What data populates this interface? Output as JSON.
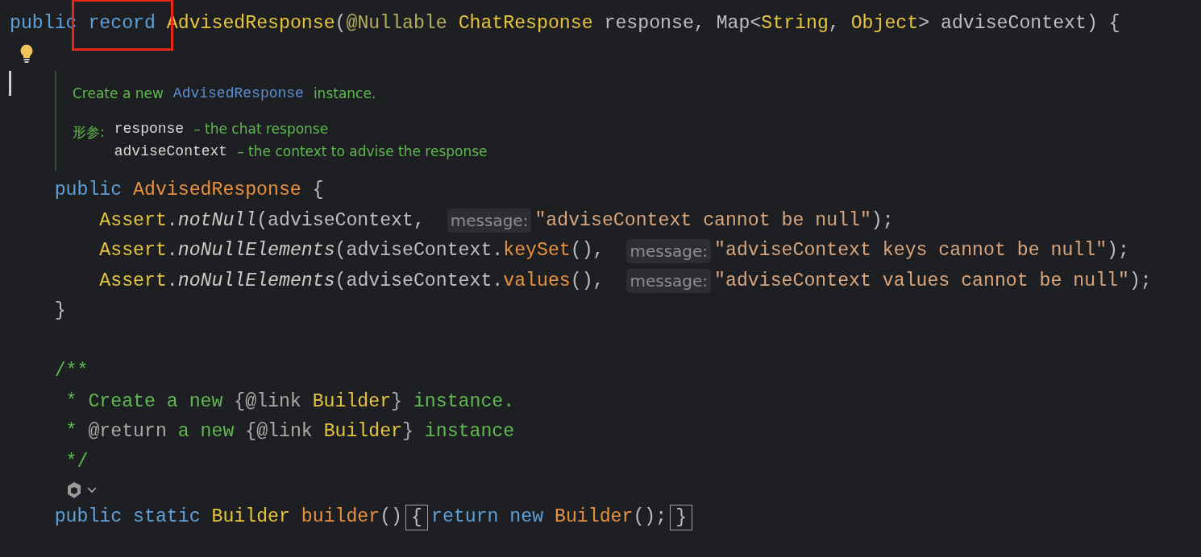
{
  "editor": {
    "lines": [
      {
        "kind": "code",
        "tokens": [
          {
            "text": "public ",
            "kind": "keyword"
          },
          {
            "text": "record",
            "kind": "keyword",
            "highlighted": true
          },
          {
            "text": " AdvisedResponse",
            "kind": "type"
          },
          {
            "text": "(",
            "kind": "plain"
          },
          {
            "text": "@Nullable ",
            "kind": "annotation"
          },
          {
            "text": "ChatResponse",
            "kind": "type"
          },
          {
            "text": " response, Map<",
            "kind": "plain"
          },
          {
            "text": "String",
            "kind": "type"
          },
          {
            "text": ", ",
            "kind": "plain"
          },
          {
            "text": "Object",
            "kind": "type"
          },
          {
            "text": "> adviseContext) {",
            "kind": "plain"
          }
        ]
      },
      {
        "kind": "bulb"
      },
      {
        "kind": "doc",
        "summary": [
          {
            "text": "Create a new",
            "kind": "text"
          },
          {
            "text": "AdvisedResponse",
            "kind": "code"
          },
          {
            "text": "instance.",
            "kind": "text"
          }
        ],
        "params_label": "形参:",
        "params": [
          {
            "name": "response",
            "description": "– the chat response"
          },
          {
            "name": "adviseContext",
            "description": "– the context to advise the response"
          }
        ]
      },
      {
        "kind": "code",
        "tokens": [
          {
            "text": "    public ",
            "kind": "keyword"
          },
          {
            "text": "AdvisedResponse",
            "kind": "decl"
          },
          {
            "text": " {",
            "kind": "plain"
          }
        ]
      },
      {
        "kind": "code",
        "tokens": [
          {
            "text": "        Assert",
            "kind": "type"
          },
          {
            "text": ".",
            "kind": "plain"
          },
          {
            "text": "notNull",
            "kind": "italic"
          },
          {
            "text": "(adviseContext, ",
            "kind": "plain"
          },
          {
            "text": "message:",
            "kind": "hint"
          },
          {
            "text": "\"adviseContext cannot be null\"",
            "kind": "string"
          },
          {
            "text": ");",
            "kind": "plain"
          }
        ]
      },
      {
        "kind": "code",
        "tokens": [
          {
            "text": "        Assert",
            "kind": "type"
          },
          {
            "text": ".",
            "kind": "plain"
          },
          {
            "text": "noNullElements",
            "kind": "italic"
          },
          {
            "text": "(adviseContext.",
            "kind": "plain"
          },
          {
            "text": "keySet",
            "kind": "decl"
          },
          {
            "text": "(), ",
            "kind": "plain"
          },
          {
            "text": "message:",
            "kind": "hint"
          },
          {
            "text": "\"adviseContext keys cannot be null\"",
            "kind": "string"
          },
          {
            "text": ");",
            "kind": "plain"
          }
        ]
      },
      {
        "kind": "code",
        "tokens": [
          {
            "text": "        Assert",
            "kind": "type"
          },
          {
            "text": ".",
            "kind": "plain"
          },
          {
            "text": "noNullElements",
            "kind": "italic"
          },
          {
            "text": "(adviseContext.",
            "kind": "plain"
          },
          {
            "text": "values",
            "kind": "decl"
          },
          {
            "text": "(), ",
            "kind": "plain"
          },
          {
            "text": "message:",
            "kind": "hint"
          },
          {
            "text": "\"adviseContext values cannot be null\"",
            "kind": "string"
          },
          {
            "text": ");",
            "kind": "plain"
          }
        ]
      },
      {
        "kind": "code",
        "tokens": [
          {
            "text": "    }",
            "kind": "plain"
          }
        ]
      },
      {
        "kind": "blank"
      },
      {
        "kind": "code",
        "tokens": [
          {
            "text": "    /**",
            "kind": "comment"
          }
        ]
      },
      {
        "kind": "code",
        "tokens": [
          {
            "text": "     * Create a new ",
            "kind": "comment"
          },
          {
            "text": "{@link ",
            "kind": "comment-tag"
          },
          {
            "text": "Builder",
            "kind": "type"
          },
          {
            "text": "}",
            "kind": "comment-tag"
          },
          {
            "text": " instance.",
            "kind": "comment"
          }
        ]
      },
      {
        "kind": "code",
        "tokens": [
          {
            "text": "     * ",
            "kind": "comment"
          },
          {
            "text": "@return",
            "kind": "comment-tag"
          },
          {
            "text": " a new ",
            "kind": "comment"
          },
          {
            "text": "{@link ",
            "kind": "comment-tag"
          },
          {
            "text": "Builder",
            "kind": "type"
          },
          {
            "text": "}",
            "kind": "comment-tag"
          },
          {
            "text": " instance",
            "kind": "comment"
          }
        ]
      },
      {
        "kind": "code",
        "tokens": [
          {
            "text": "     */",
            "kind": "comment"
          }
        ]
      },
      {
        "kind": "actions"
      },
      {
        "kind": "code",
        "tokens": [
          {
            "text": "    public static ",
            "kind": "keyword"
          },
          {
            "text": "Builder ",
            "kind": "type"
          },
          {
            "text": "builder",
            "kind": "decl"
          },
          {
            "text": "()",
            "kind": "plain"
          },
          {
            "text": "{",
            "kind": "fold"
          },
          {
            "text": "return new ",
            "kind": "keyword"
          },
          {
            "text": "Builder",
            "kind": "decl"
          },
          {
            "text": "();",
            "kind": "plain"
          },
          {
            "text": "}",
            "kind": "fold"
          }
        ]
      }
    ]
  }
}
